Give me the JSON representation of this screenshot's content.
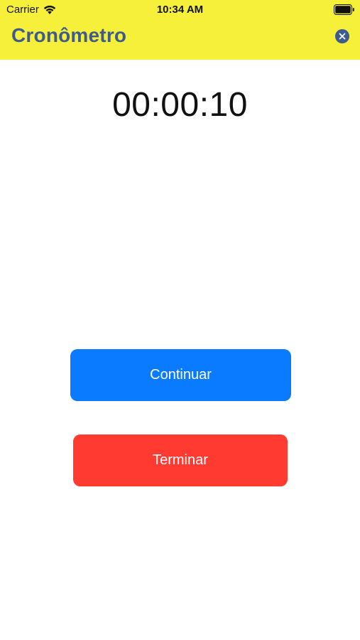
{
  "status_bar": {
    "carrier": "Carrier",
    "time": "10:34 AM",
    "icons": [
      "wifi-icon",
      "battery-icon"
    ]
  },
  "app_bar": {
    "title": "Cronômetro",
    "close_label": "x",
    "close_icon": "close-icon"
  },
  "timer": {
    "display": "00:00:10"
  },
  "actions": {
    "continue_label": "Continuar",
    "end_label": "Terminar"
  },
  "colors": {
    "header_bg": "#f7f03a",
    "title_color": "#3d5b8f",
    "continue_bg": "#0a7bff",
    "end_bg": "#ff3a30"
  }
}
